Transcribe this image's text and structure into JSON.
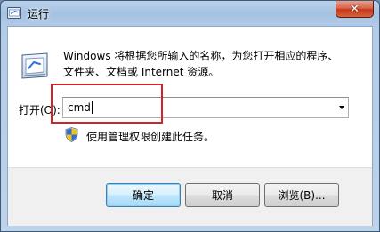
{
  "window": {
    "title": "运行",
    "close_label": "✕"
  },
  "description": {
    "line1": "Windows 将根据您所输入的名称，为您打开相应的程序、",
    "line2": "文件夹、文档或 Internet 资源。"
  },
  "open_field": {
    "label": "打开(O):",
    "value": "cmd"
  },
  "admin_notice": "使用管理权限创建此任务。",
  "buttons": {
    "ok": "确定",
    "cancel": "取消",
    "browse": "浏览(B)..."
  },
  "icons": {
    "title": "run-icon",
    "main": "run-icon",
    "shield": "uac-shield-icon",
    "dropdown": "chevron-down-icon"
  },
  "colors": {
    "highlight": "#d3232a",
    "close_button": "#c3381a",
    "default_button_border": "#3c7fb1"
  }
}
